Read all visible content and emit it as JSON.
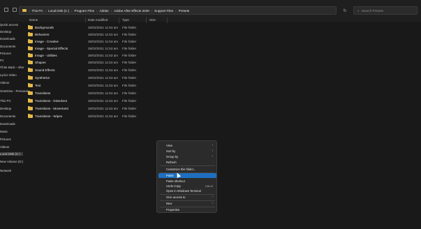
{
  "breadcrumb": [
    "This PC",
    "Local Disk (C:)",
    "Program Files",
    "Adobe",
    "Adobe After Effects 2020",
    "Support Files",
    "Presets"
  ],
  "search": {
    "placeholder": "Search Presets"
  },
  "sidebar": {
    "items": [
      {
        "label": "Quick access"
      },
      {
        "label": "Desktop"
      },
      {
        "label": "Downloads"
      },
      {
        "label": "Documents"
      },
      {
        "label": "Pictures"
      },
      {
        "label": "P1"
      },
      {
        "label": "I'll Be Back - After"
      },
      {
        "label": "Lyrics Video"
      },
      {
        "label": "Videos"
      },
      {
        "label": "OneDrive - Personal"
      },
      {
        "label": "This PC"
      },
      {
        "label": "Desktop"
      },
      {
        "label": "Documents"
      },
      {
        "label": "Downloads"
      },
      {
        "label": "Music"
      },
      {
        "label": "Pictures"
      },
      {
        "label": "Videos"
      },
      {
        "label": "Local Disk (C:)",
        "selected": true
      },
      {
        "label": "New Volume (D:)"
      },
      {
        "label": "Network"
      }
    ]
  },
  "columns": {
    "name": "Name",
    "date": "Date modified",
    "type": "Type",
    "size": "Size"
  },
  "files": [
    {
      "name": "Backgrounds",
      "date": "25/02/2021 11:53 am",
      "type": "File folder"
    },
    {
      "name": "Behaviors",
      "date": "25/02/2021 11:53 am",
      "type": "File folder"
    },
    {
      "name": "Image - Creative",
      "date": "25/02/2021 11:53 am",
      "type": "File folder"
    },
    {
      "name": "Image - Special Effects",
      "date": "25/02/2021 11:53 am",
      "type": "File folder"
    },
    {
      "name": "Image - Utilities",
      "date": "25/02/2021 11:53 am",
      "type": "File folder"
    },
    {
      "name": "Shapes",
      "date": "25/02/2021 11:53 am",
      "type": "File folder"
    },
    {
      "name": "Sound Effects",
      "date": "25/02/2021 11:53 am",
      "type": "File folder"
    },
    {
      "name": "Synthetics",
      "date": "25/02/2021 11:53 am",
      "type": "File folder"
    },
    {
      "name": "Text",
      "date": "25/02/2021 11:53 am",
      "type": "File folder"
    },
    {
      "name": "Transitions",
      "date": "25/02/2021 11:53 am",
      "type": "File folder"
    },
    {
      "name": "Transitions - Dissolves",
      "date": "25/02/2021 11:53 am",
      "type": "File folder"
    },
    {
      "name": "Transitions - Movement",
      "date": "25/02/2021 11:53 am",
      "type": "File folder"
    },
    {
      "name": "Transitions - Wipes",
      "date": "25/02/2021 11:53 am",
      "type": "File folder"
    }
  ],
  "context_menu": {
    "view": "View",
    "sort_by": "Sort by",
    "group_by": "Group by",
    "refresh": "Refresh",
    "customize": "Customize this folder...",
    "paste": "Paste",
    "paste_shortcut": "Paste shortcut",
    "undo_copy": "Undo Copy",
    "undo_copy_shortcut": "Ctrl+Z",
    "open_terminal": "Open in Windows Terminal",
    "give_access": "Give access to",
    "new": "New",
    "properties": "Properties"
  },
  "colors": {
    "accent": "#1e6fbf",
    "folder": "#e2b84a",
    "background": "#191919"
  }
}
